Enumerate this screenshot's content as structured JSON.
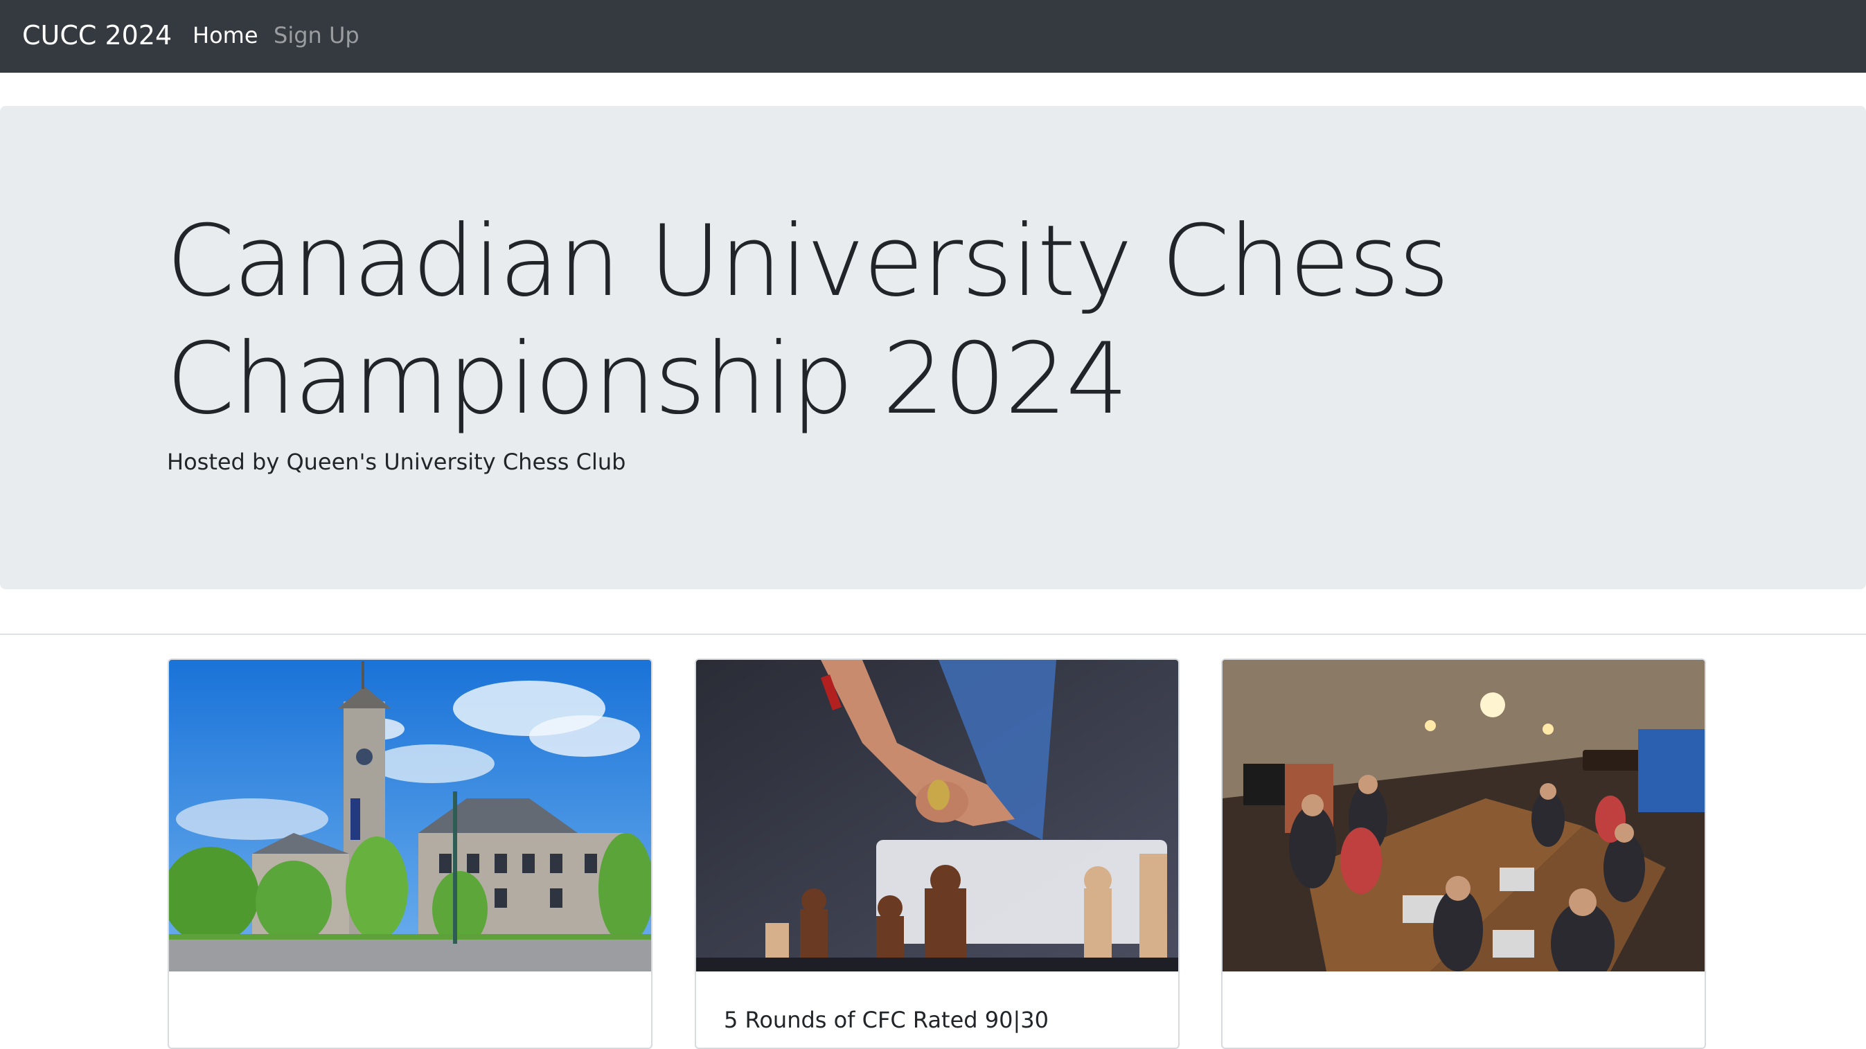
{
  "nav": {
    "brand": "CUCC 2024",
    "links": [
      {
        "label": "Home",
        "active": true
      },
      {
        "label": "Sign Up",
        "active": false
      }
    ]
  },
  "hero": {
    "title": "Canadian University Chess Championship 2024",
    "subtitle": "Hosted by Queen's University Chess Club"
  },
  "cards": [
    {
      "image": "university-building-photo",
      "title": ""
    },
    {
      "image": "chess-move-photo",
      "title": "5 Rounds of CFC Rated 90|30"
    },
    {
      "image": "chess-club-pub-photo",
      "title": ""
    }
  ],
  "colors": {
    "navbar": "#343a40",
    "hero_background": "#e9ecef",
    "text": "#212529"
  }
}
